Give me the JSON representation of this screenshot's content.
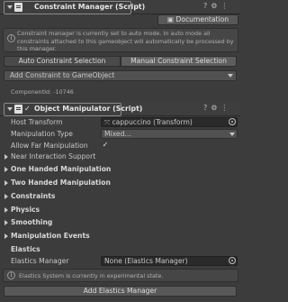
{
  "constraint_manager": {
    "title": "Constraint Manager (Script)",
    "documentation_label": "Documentation",
    "help_text": "Constraint manager is currently set to auto mode. In auto mode all constraints attached to this gameobject will automatically be processed by this manager.",
    "tabs": [
      "Auto Constraint Selection",
      "Manual Constraint Selection"
    ],
    "add_constraint_label": "Add Constraint to GameObject",
    "component_id": "ComponentId: -10746"
  },
  "object_manipulator": {
    "title": "Object Manipulator (Script)",
    "checkmark": "✓",
    "rows": {
      "host_transform_label": "Host Transform",
      "host_transform_value": "cappuccino (Transform)",
      "manipulation_type_label": "Manipulation Type",
      "manipulation_type_value": "Mixed...",
      "allow_far_label": "Allow Far Manipulation",
      "allow_far_value": "✓"
    },
    "sections": [
      "Near Interaction Support",
      "One Handed Manipulation",
      "Two Handed Manipulation",
      "Constraints",
      "Physics",
      "Smoothing",
      "Manipulation Events"
    ],
    "elastics_heading": "Elastics",
    "elastics_manager_label": "Elastics Manager",
    "elastics_manager_value": "None (Elastics Manager)",
    "elastics_warning": "Elastics System is currently in experimental state.",
    "add_elastics_label": "Add Elastics Manager"
  },
  "icons": [
    "script-icon",
    "help-icon",
    "settings-icon",
    "more-icon",
    "book-icon",
    "info-icon",
    "caret-icon",
    "target-icon"
  ]
}
